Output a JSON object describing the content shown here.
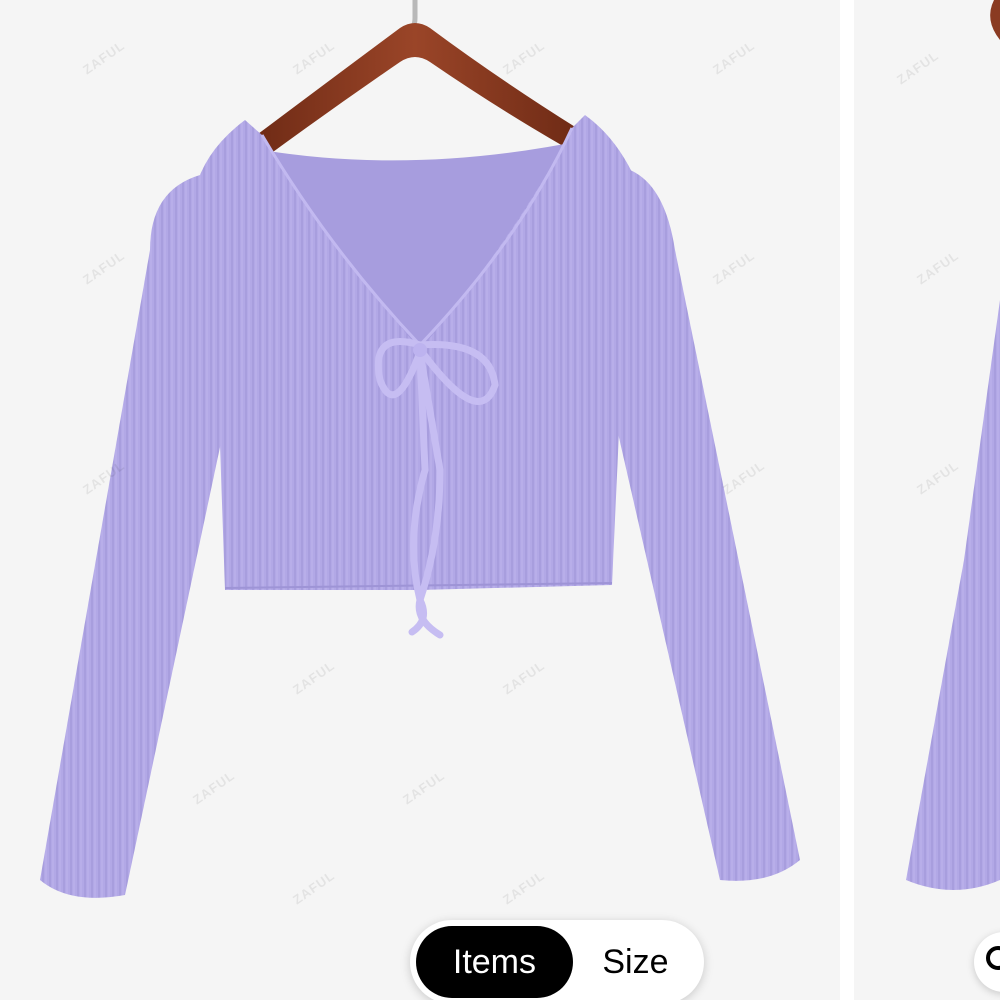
{
  "gallery": {
    "tabs": [
      {
        "label": "Items",
        "active": true
      },
      {
        "label": "Size",
        "active": false
      }
    ],
    "watermark_text": "ZAFUL",
    "product": {
      "garment_color": "#b3a9e6",
      "hanger_color": "#8a3b22"
    },
    "next_slide_icon": "search-icon"
  }
}
